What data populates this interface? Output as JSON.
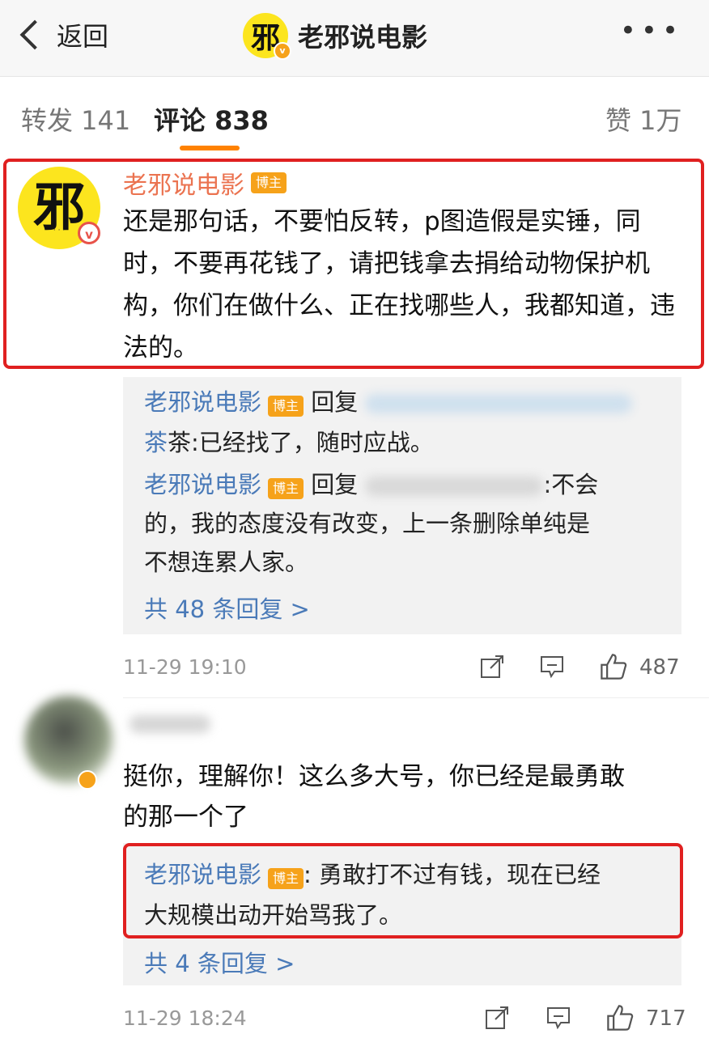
{
  "nav": {
    "back_label": "返回",
    "title": "老邪说电影",
    "logo_glyph": "邪",
    "more_label": "•••"
  },
  "tabs": [
    {
      "label": "转发 141"
    },
    {
      "label": "评论 838"
    },
    {
      "label": "赞 1万"
    }
  ],
  "comments": [
    {
      "author": "老邪说电影",
      "badge": "博主",
      "avatar_glyph": "邪",
      "avatar_verified": "v",
      "text": "还是那句话，不要怕反转，p图造假是实锤，同时，不要再花钱了，请把钱拿去捐给动物保护机构，你们在做什么、正在找哪些人，我都知道，违法的。",
      "replies": [
        {
          "author": "老邪说电影",
          "badge": "博主",
          "action": "回复",
          "text_line2": "茶:已经找了，随时应战。"
        },
        {
          "author": "老邪说电影",
          "badge": "博主",
          "action": "回复",
          "text_end": ":不会",
          "text_lines": [
            "的，我的态度没有改变，上一条删除单纯是",
            "不想连累人家。"
          ]
        }
      ],
      "more_replies": "共 48 条回复 >",
      "time": "11-29 19:10",
      "likes": "487"
    },
    {
      "text_line1": "挺你，理解你！这么多大号，你已经是最勇敢",
      "text_line2": "的那一个了",
      "reply": {
        "author": "老邪说电影",
        "badge": "博主",
        "text_line1": ": 勇敢打不过有钱，现在已经",
        "text_line2": "大规模出动开始骂我了。"
      },
      "more_replies": "共 4 条回复 >",
      "time": "11-29 18:24",
      "likes": "717"
    }
  ],
  "colors": {
    "accent": "#ff8200",
    "link": "#4a7ab8",
    "highlight": "#e02020",
    "name": "#eb7350"
  }
}
